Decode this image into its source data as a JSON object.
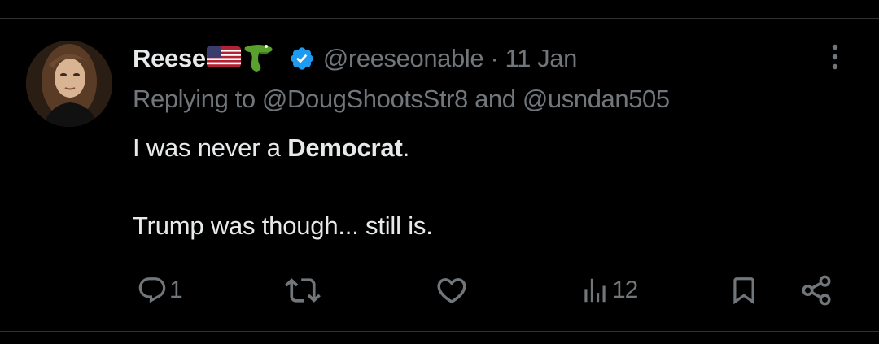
{
  "tweet": {
    "author_name": "Reese",
    "name_emojis": [
      "us-flag-emoji",
      "crocodile-emoji"
    ],
    "verified": true,
    "handle": "@reeseonable",
    "separator": "·",
    "date": "11 Jan",
    "replying_prefix": "Replying to",
    "replying_to": [
      "@DougShootsStr8",
      "@usndan505"
    ],
    "replying_joiner": "and",
    "text_line1_prefix": "I was never a ",
    "text_line1_bold": "Democrat",
    "text_line1_suffix": ".",
    "text_line2": "Trump was though... still is."
  },
  "actions": {
    "reply_count": "1",
    "retweet_count": "",
    "like_count": "",
    "views_count": "12"
  },
  "colors": {
    "background": "#000000",
    "text": "#e7e9ea",
    "muted": "#71767b",
    "verified_blue": "#1d9bf0",
    "divider": "#2f3336"
  },
  "icons": [
    "more-options-icon",
    "verified-badge-icon",
    "reply-icon",
    "retweet-icon",
    "like-icon",
    "views-icon",
    "bookmark-icon",
    "share-icon"
  ]
}
